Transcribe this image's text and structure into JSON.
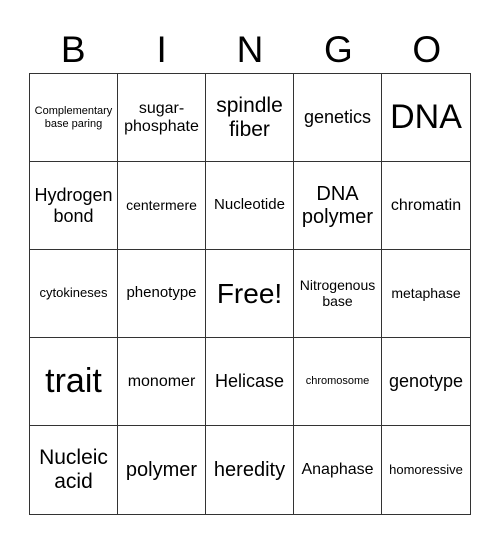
{
  "title_letters": [
    "B",
    "I",
    "N",
    "G",
    "O"
  ],
  "cells": [
    [
      "Complementary base paring",
      "sugar-phosphate",
      "spindle fiber",
      "genetics",
      "DNA"
    ],
    [
      "Hydrogen bond",
      "centermere",
      "Nucleotide",
      "DNA polymer",
      "chromatin"
    ],
    [
      "cytokineses",
      "phenotype",
      "Free!",
      "Nitrogenous base",
      "metaphase"
    ],
    [
      "trait",
      "monomer",
      "Helicase",
      "chromosome",
      "genotype"
    ],
    [
      "Nucleic acid",
      "polymer",
      "heredity",
      "Anaphase",
      "homoressive"
    ]
  ]
}
